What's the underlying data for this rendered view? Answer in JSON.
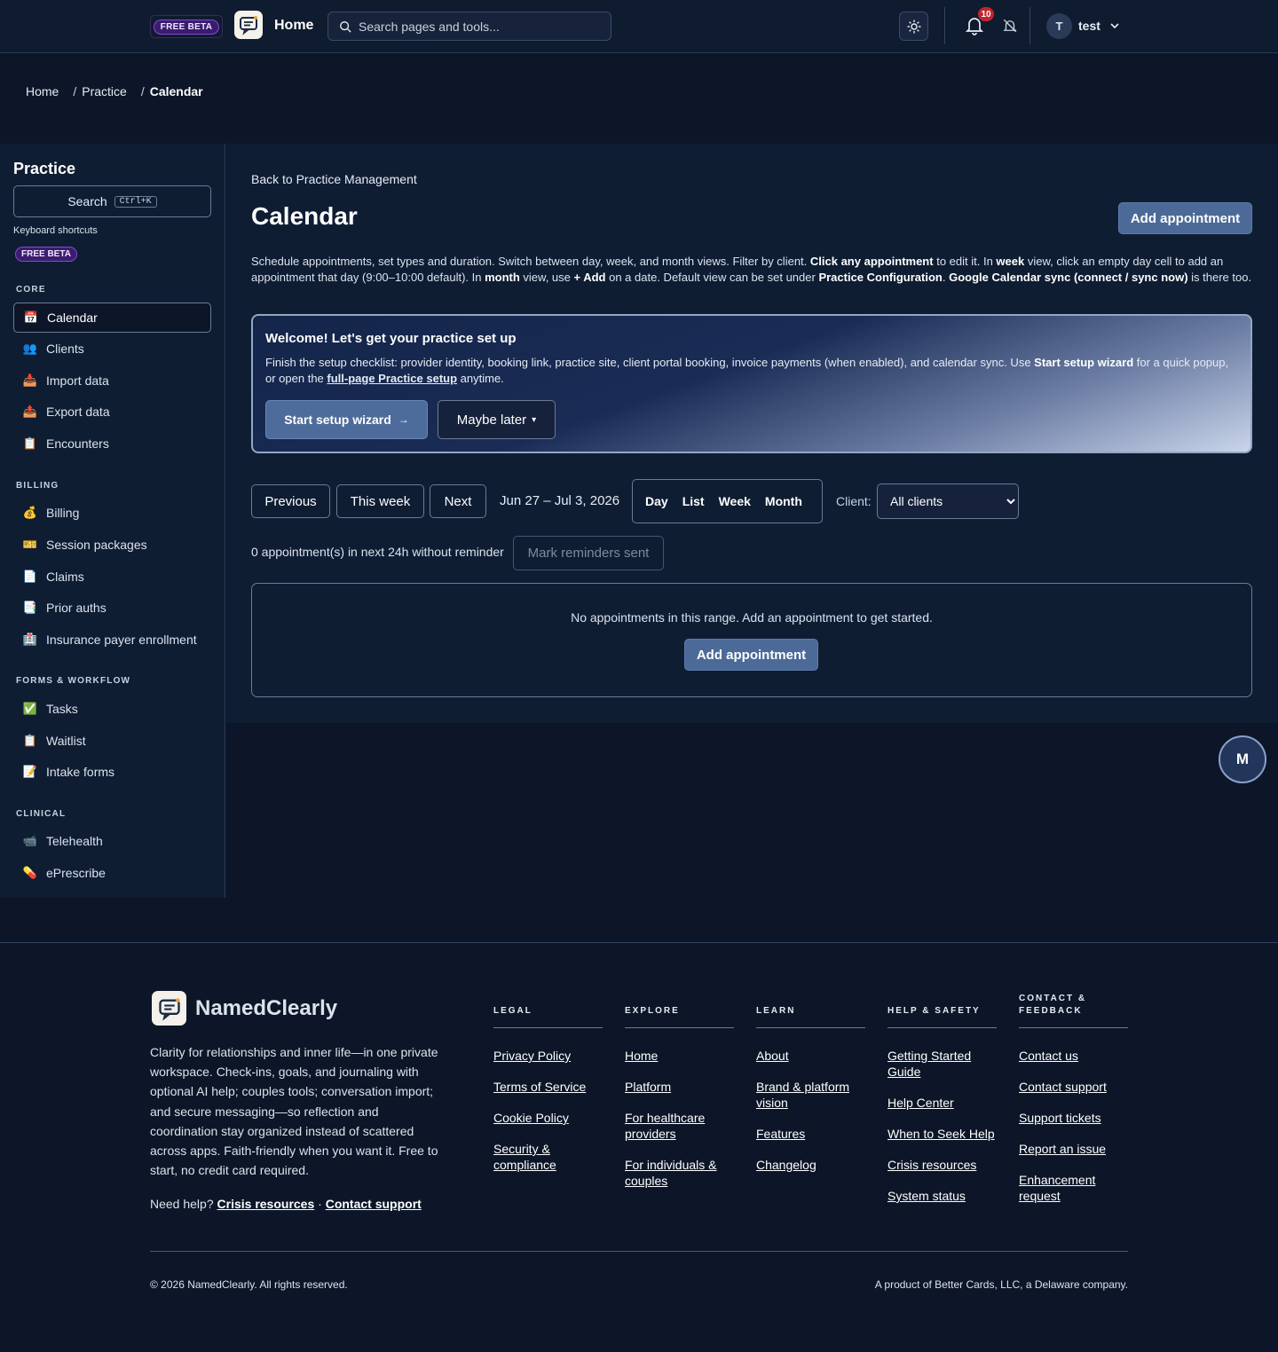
{
  "topbar": {
    "beta_label": "FREE BETA",
    "home_label": "Home",
    "search_placeholder": "Search pages and tools...",
    "notification_count": "10",
    "user_initial": "T",
    "user_name": "test",
    "icons": [
      "logo-icon",
      "search-icon",
      "sun-icon",
      "bell-icon",
      "bell-off-icon",
      "chevron-down-icon"
    ]
  },
  "breadcrumb": {
    "items": [
      "Home",
      "Practice"
    ],
    "separator": "/",
    "current": "Calendar"
  },
  "sidebar": {
    "title": "Practice",
    "search_label": "Search",
    "search_kbd": "Ctrl+K",
    "shortcuts_label": "Keyboard shortcuts",
    "beta_label": "FREE BETA",
    "sections": [
      {
        "title": "CORE",
        "items": [
          {
            "label": "Calendar",
            "icon": "📅",
            "active": true
          },
          {
            "label": "Clients",
            "icon": "👥"
          },
          {
            "label": "Import data",
            "icon": "📥"
          },
          {
            "label": "Export data",
            "icon": "📤"
          },
          {
            "label": "Encounters",
            "icon": "📋"
          }
        ]
      },
      {
        "title": "BILLING",
        "items": [
          {
            "label": "Billing",
            "icon": "💰"
          },
          {
            "label": "Session packages",
            "icon": "🎫"
          },
          {
            "label": "Claims",
            "icon": "📄"
          },
          {
            "label": "Prior auths",
            "icon": "📑"
          },
          {
            "label": "Insurance payer enrollment",
            "icon": "🏥"
          }
        ]
      },
      {
        "title": "FORMS & WORKFLOW",
        "items": [
          {
            "label": "Tasks",
            "icon": "✅"
          },
          {
            "label": "Waitlist",
            "icon": "📋"
          },
          {
            "label": "Intake forms",
            "icon": "📝"
          }
        ]
      },
      {
        "title": "CLINICAL",
        "items": [
          {
            "label": "Telehealth",
            "icon": "📹"
          },
          {
            "label": "ePrescribe",
            "icon": "💊"
          }
        ]
      }
    ]
  },
  "main": {
    "back_link": "Back to Practice Management",
    "title": "Calendar",
    "add_appointment": "Add appointment",
    "description": {
      "p1": "Schedule appointments, set types and duration. Switch between day, week, and month views. Filter by client. ",
      "b1": "Click any appointment",
      "p2": " to edit it. In ",
      "b2": "week",
      "p3": " view, click an empty day cell to add an appointment that day (9:00–10:00 default). In ",
      "b3": "month",
      "p4": " view, use ",
      "b4": "+ Add",
      "p5": " on a date. Default view can be set under ",
      "b5": "Practice Configuration",
      "p6": ". ",
      "b6": "Google Calendar sync (connect / sync now)",
      "p7": " is there too."
    },
    "welcome": {
      "title": "Welcome! Let's get your practice set up",
      "text1": "Finish the setup checklist: provider identity, booking link, practice site, client portal booking, invoice payments (when enabled), and calendar sync. Use ",
      "bold": "Start setup wizard",
      "text2": " for a quick popup, or open the ",
      "link": "full-page Practice setup",
      "text3": " anytime.",
      "wizard_button": "Start setup wizard",
      "wizard_arrow": "→",
      "maybe_button": "Maybe later",
      "maybe_caret": "▾"
    },
    "nav": {
      "previous": "Previous",
      "this_week": "This week",
      "next": "Next",
      "range": "Jun 27 – Jul 3, 2026",
      "views": [
        "Day",
        "List",
        "Week",
        "Month"
      ],
      "client_label": "Client:",
      "client_selected": "All clients"
    },
    "reminders": {
      "text": "0 appointment(s) in next 24h without reminder",
      "button": "Mark reminders sent"
    },
    "empty": {
      "text": "No appointments in this range. Add an appointment to get started.",
      "button": "Add appointment"
    },
    "fab_label": "M"
  },
  "footer": {
    "brand": "NamedClearly",
    "tagline": "Clarity for relationships and inner life—in one private workspace. Check-ins, goals, and journaling with optional AI help; couples tools; conversation import; and secure messaging—so reflection and coordination stay organized instead of scattered across apps. Faith-friendly when you want it. Free to start, no credit card required.",
    "help_prefix": "Need help?",
    "help_crisis": "Crisis resources",
    "help_dot": "·",
    "help_contact": "Contact support",
    "columns": [
      {
        "title": "LEGAL",
        "links": [
          "Privacy Policy",
          "Terms of Service",
          "Cookie Policy",
          "Security & compliance"
        ]
      },
      {
        "title": "EXPLORE",
        "links": [
          "Home",
          "Platform",
          "For healthcare providers",
          "For individuals & couples"
        ]
      },
      {
        "title": "LEARN",
        "links": [
          "About",
          "Brand & platform vision",
          "Features",
          "Changelog"
        ]
      },
      {
        "title": "HELP & SAFETY",
        "links": [
          "Getting Started Guide",
          "Help Center",
          "When to Seek Help",
          "Crisis resources",
          "System status"
        ]
      },
      {
        "title": "CONTACT & FEEDBACK",
        "links": [
          "Contact us",
          "Contact support",
          "Support tickets",
          "Report an issue",
          "Enhancement request"
        ]
      }
    ],
    "copyright": "© 2026 NamedClearly. All rights reserved.",
    "product_of": "A product of Better Cards, LLC, a Delaware company."
  }
}
